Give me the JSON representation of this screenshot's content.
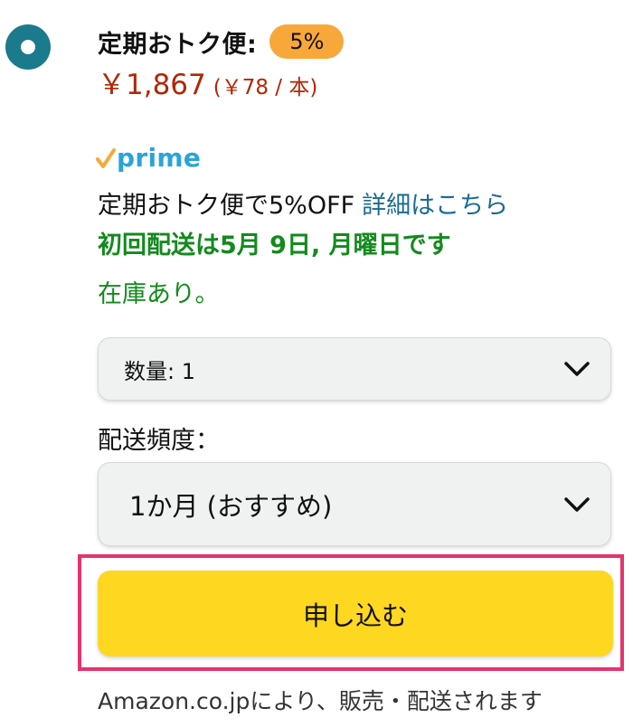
{
  "plan": {
    "title": "定期おトク便:",
    "discount_badge": "5%",
    "price": "￥1,867",
    "unit_price": "(￥78 / 本)"
  },
  "prime": {
    "logo_text": "prime",
    "logo_color": "#2aa4d8",
    "check_color": "#f8a83a"
  },
  "offer": {
    "text": "定期おトク便で5%OFF",
    "details_link": "詳細はこちら"
  },
  "delivery": {
    "text": "初回配送は5月 9日, 月曜日です"
  },
  "stock": {
    "text": "在庫あり。"
  },
  "quantity": {
    "label": "数量: 1"
  },
  "frequency": {
    "label": "配送頻度：",
    "selected": "1か月 (おすすめ)"
  },
  "subscribe": {
    "label": "申し込む"
  },
  "seller": {
    "text": "Amazon.co.jpにより、販売・配送されます"
  },
  "colors": {
    "price_red": "#b12704",
    "success_green": "#138a1d",
    "link_blue": "#1b6a93",
    "button_yellow": "#fdd720",
    "radio_teal": "#1b7a8c",
    "highlight_pink": "#e8326e",
    "badge_orange": "#f8a83a"
  },
  "icons": {
    "radio": "radio-selected-icon",
    "chevron": "chevron-down-icon",
    "prime_check": "prime-check-icon"
  }
}
